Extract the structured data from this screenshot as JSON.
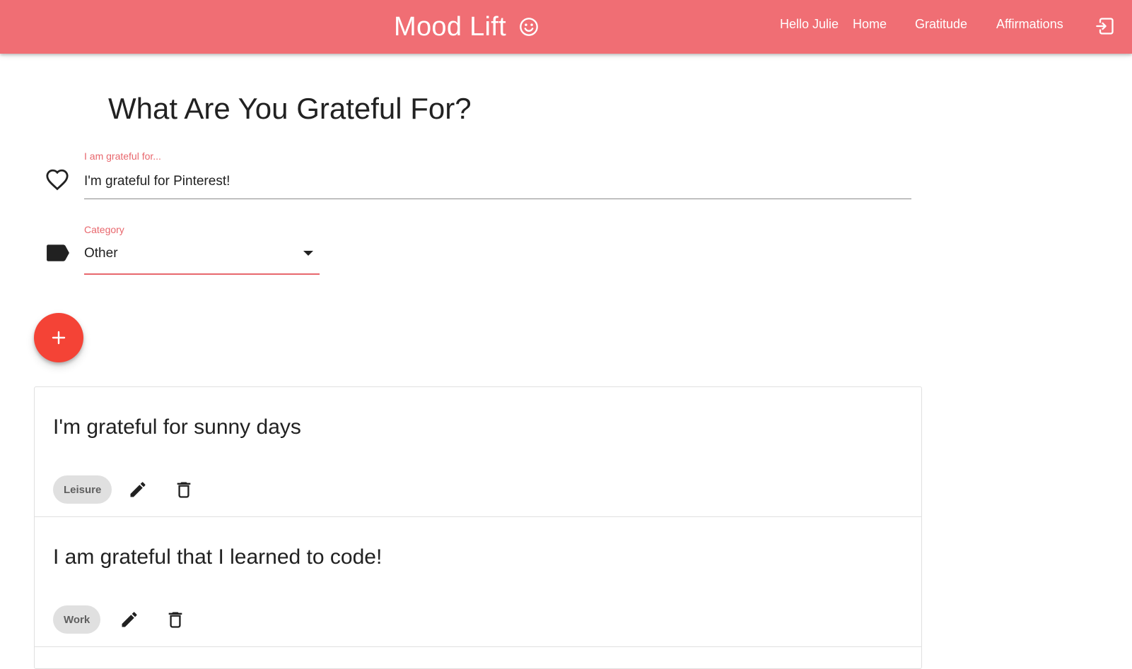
{
  "header": {
    "brand": "Mood Lift",
    "brand_icon": "smiley-icon",
    "greeting": "Hello Julie",
    "nav": [
      {
        "label": "Home"
      },
      {
        "label": "Gratitude"
      },
      {
        "label": "Affirmations"
      }
    ],
    "logout_icon": "logout-icon",
    "background": "#f06e74"
  },
  "page": {
    "title": "What Are You Grateful For?"
  },
  "form": {
    "gratitude": {
      "label": "I am grateful for...",
      "value": "I'm grateful for Pinterest!",
      "icon": "heart-outline-icon"
    },
    "category": {
      "label": "Category",
      "value": "Other",
      "icon": "label-tag-icon"
    },
    "accent": "#e8676d",
    "add_button_icon": "plus-icon",
    "add_button_color": "#f44336"
  },
  "entries": [
    {
      "text": "I'm grateful for sunny days",
      "category": "Leisure"
    },
    {
      "text": "I am grateful that I learned to code!",
      "category": "Work"
    }
  ]
}
